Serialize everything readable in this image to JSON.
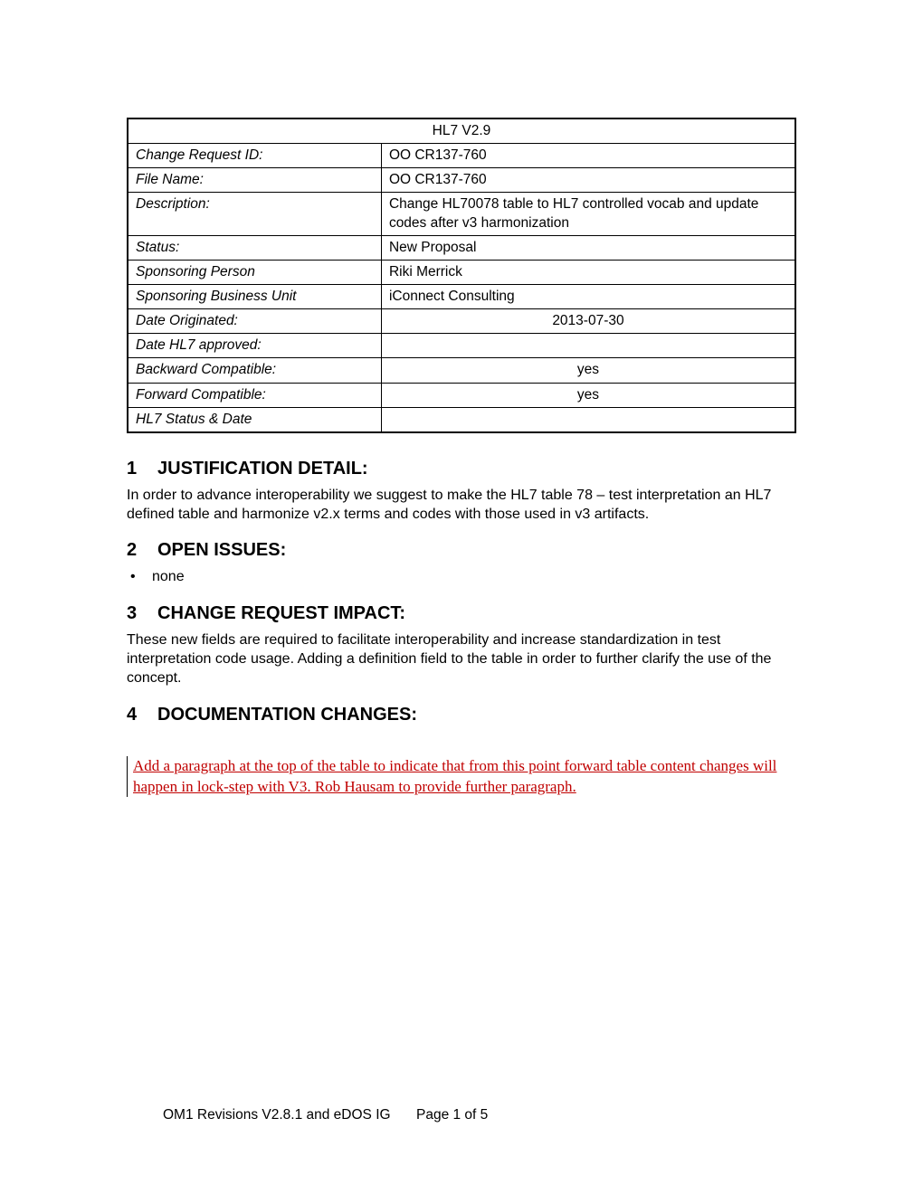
{
  "table": {
    "header": "HL7 V2.9",
    "rows": [
      {
        "label": "Change Request ID:",
        "value": "OO CR137-760",
        "center": false
      },
      {
        "label": "File Name:",
        "value": "OO CR137-760",
        "center": false
      },
      {
        "label": "Description:",
        "value": "Change HL70078 table to HL7 controlled vocab and update codes after v3 harmonization",
        "center": false
      },
      {
        "label": "Status:",
        "value": "New Proposal",
        "center": false
      },
      {
        "label": "Sponsoring Person",
        "value": "Riki Merrick",
        "center": false
      },
      {
        "label": "Sponsoring Business Unit",
        "value": "iConnect Consulting",
        "center": false
      },
      {
        "label": "Date Originated:",
        "value": "2013-07-30",
        "center": true
      },
      {
        "label": "Date HL7 approved:",
        "value": "",
        "center": true
      },
      {
        "label": "Backward Compatible:",
        "value": "yes",
        "center": true
      },
      {
        "label": "Forward Compatible:",
        "value": "yes",
        "center": true
      },
      {
        "label": "HL7 Status & Date",
        "value": "",
        "center": true
      }
    ]
  },
  "sections": {
    "s1": {
      "num": "1",
      "title": "JUSTIFICATION DETAIL:",
      "body": "In order to advance interoperability we suggest to make the HL7 table 78 – test interpretation an HL7 defined table and harmonize v2.x terms and codes with those used in v3 artifacts."
    },
    "s2": {
      "num": "2",
      "title": "OPEN ISSUES:",
      "item": "none"
    },
    "s3": {
      "num": "3",
      "title": "CHANGE REQUEST IMPACT:",
      "body": "These new fields are required to facilitate interoperability and increase standardization in test interpretation code usage. Adding a definition field to the table in order to further clarify the use of the concept."
    },
    "s4": {
      "num": "4",
      "title": "DOCUMENTATION CHANGES:",
      "tracked": "Add a paragraph at the top of the table to indicate that from this point forward table content changes will happen in lock-step with V3.  Rob Hausam to provide further paragraph."
    }
  },
  "footer": {
    "left": "OM1 Revisions V2.8.1 and eDOS IG",
    "center": "Page 1 of 5"
  }
}
